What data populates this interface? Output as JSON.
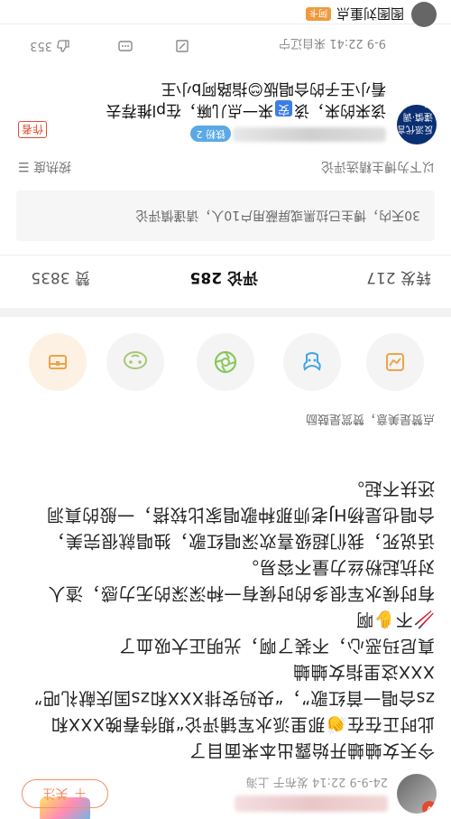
{
  "post": {
    "meta": "24-9-9 22:14 发布于 上海",
    "follow_label": "关注",
    "text_lines": [
      "今天女蛐蛐开始露出本来面目了",
      "此时正在在👏那里派水军铺评论“期待春晚XXX和",
      "zs合唱一首红歌”，“央妈安排XXX和zs国庆献礼吧”",
      "XXX这里指女蛐蛐",
      "真尼玛恶心，不装了啊，光明正大吸血了",
      "🥢不✋啊",
      "有时候水军很多的时候有一种深深的无力感，渣人",
      "对抗起粉丝力量不容易。",
      "话说死，我们超级喜欢深唱红歌，独唱就很完美，",
      "合唱也是杨HJ老师那种歌唱家比较搭，一般的真洞",
      "还扶不起。"
    ]
  },
  "reactions": {
    "prompt": "点赞是美意，赞赏是鼓励",
    "items": [
      {
        "name": "reward",
        "icon": "treasure-icon",
        "color": "#f0a24a"
      },
      {
        "name": "duck",
        "icon": "duck-icon",
        "color": "#a6c773"
      },
      {
        "name": "lens",
        "icon": "aperture-icon",
        "color": "#87c85c"
      },
      {
        "name": "ox",
        "icon": "ox-icon",
        "color": "#45a7e0"
      },
      {
        "name": "trend",
        "icon": "trend-icon",
        "color": "#f0a24a"
      }
    ]
  },
  "tabs": {
    "repost": "转发 217",
    "comment": "评论 285",
    "like": "赞 3835"
  },
  "notice": "30天内，博主已拉黑或屏蔽用户10人，请谨慎评论",
  "selected": {
    "title": "以下为博主精选评论",
    "sort": "按热度 ☰"
  },
  "comment": {
    "fan_label": "铁粉 2",
    "author_label": "作者",
    "avatar_line1": "反派代言",
    "avatar_line2": "谨慎·调侃",
    "text_part1": "该来的来，该",
    "keyword": "安",
    "text_part2": "来一点儿嘛，在pl推荐去",
    "text_line2": "看小王子的合唱版😊指路阿b小王",
    "time": "9-9 22:41 来自辽宁",
    "like_count": "353"
  },
  "bottom": {
    "text": "图图刘重点",
    "badge": "阿卡"
  },
  "colors": {
    "accent": "#f08f66",
    "keyword_bg": "#3d7de8",
    "fan_badge": "#5aa9e6"
  }
}
